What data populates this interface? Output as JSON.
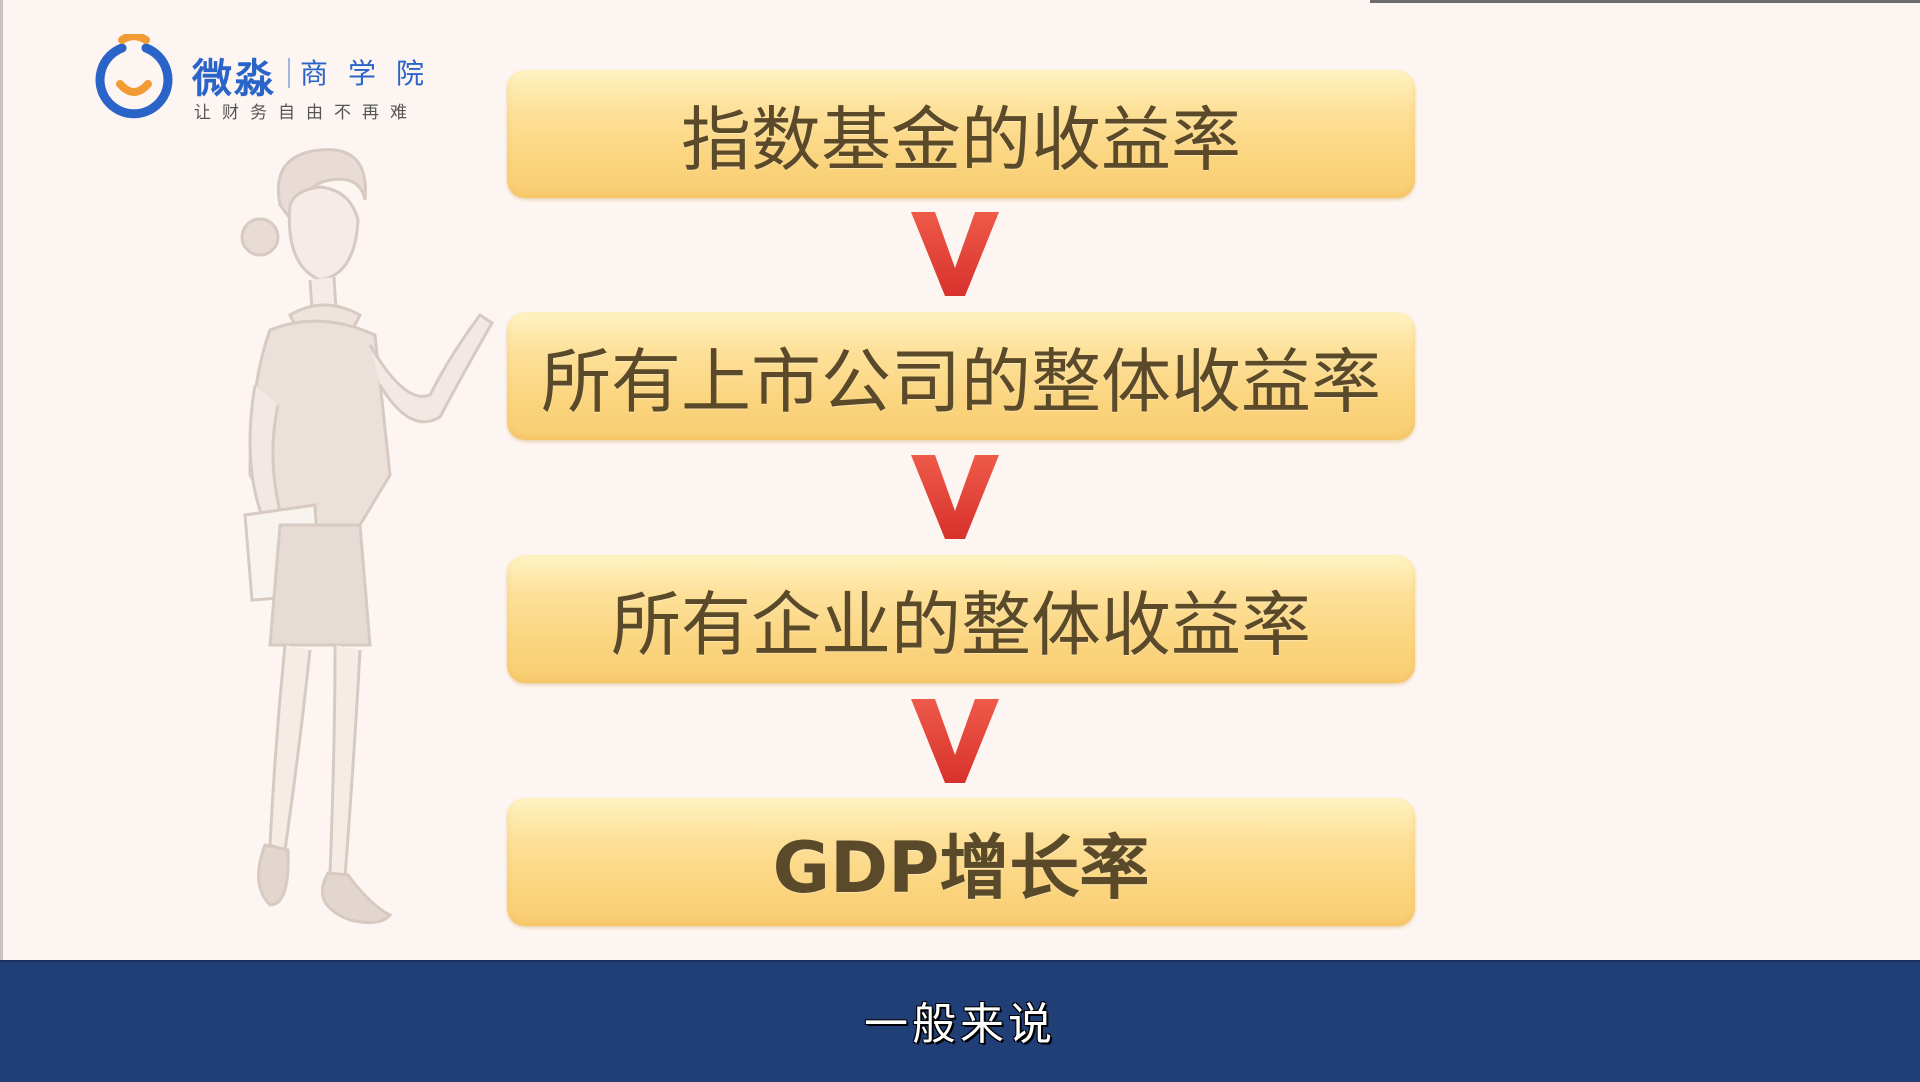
{
  "logo": {
    "name": "微淼",
    "sub": "商学院",
    "slogan": "让财务自由不再难",
    "ring_color": "#2a64c8",
    "accent_color": "#f29a33"
  },
  "chain": {
    "items": [
      "指数基金的收益率",
      "所有上市公司的整体收益率",
      "所有企业的整体收益率",
      "GDP增长率"
    ],
    "comparator_icon": "greater-than-sign-icon",
    "comparator_color": "#e23a33",
    "box_color": "#fbd47e"
  },
  "subtitle": {
    "text": "一般来说",
    "bar_color": "#213f77"
  }
}
